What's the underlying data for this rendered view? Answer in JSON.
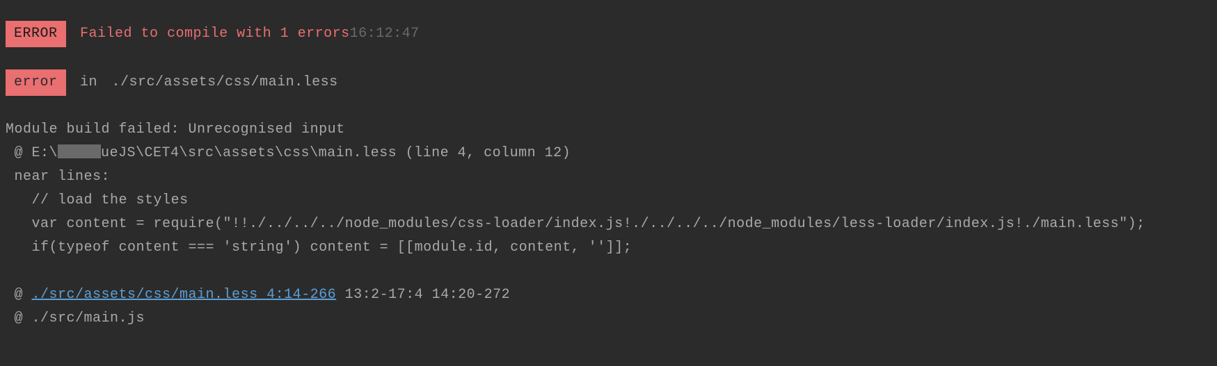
{
  "line1": {
    "badge": "ERROR",
    "message": "Failed to compile with 1 errors",
    "timestamp": "16:12:47"
  },
  "line2": {
    "badge": "error",
    "prefix": " in ",
    "path": "./src/assets/css/main.less"
  },
  "module": {
    "failed": "Module build failed: Unrecognised input",
    "at": " @ E:\\",
    "path_rest": "ueJS\\CET4\\src\\assets\\css\\main.less (line 4, column 12)",
    "near": " near lines:",
    "comment": "   // load the styles",
    "var_line": "   var content = require(\"!!./../../../node_modules/css-loader/index.js!./../../../node_modules/less-loader/index.js!./main.less\");",
    "if_line": "   if(typeof content === 'string') content = [[module.id, content, '']];"
  },
  "footer": {
    "at1": " @ ",
    "link": "./src/assets/css/main.less 4:14-266",
    "rest": " 13:2-17:4 14:20-272",
    "at2": " @ ./src/main.js"
  }
}
